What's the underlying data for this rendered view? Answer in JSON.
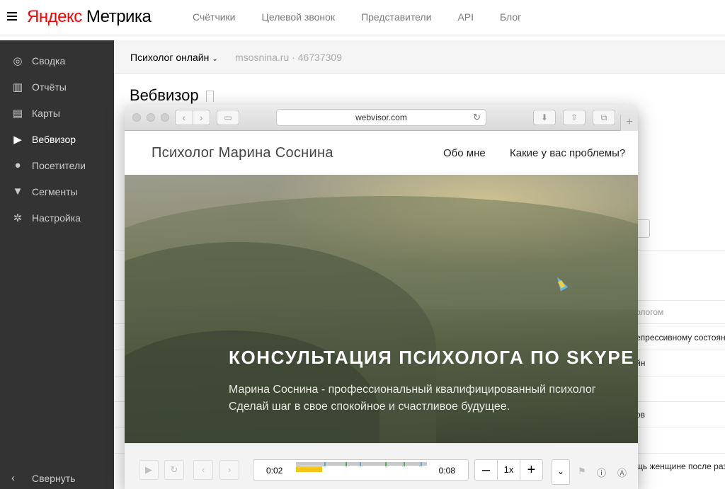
{
  "app": {
    "logo_brand": "Яндекс",
    "logo_product": "Метрика",
    "top_nav": [
      "Счётчики",
      "Целевой звонок",
      "Представители",
      "API",
      "Блог"
    ]
  },
  "sidebar": {
    "items": [
      {
        "label": "Сводка",
        "icon": "gauge-icon",
        "glyph": "◎"
      },
      {
        "label": "Отчёты",
        "icon": "bar-chart-icon",
        "glyph": "▥"
      },
      {
        "label": "Карты",
        "icon": "map-icon",
        "glyph": "▤"
      },
      {
        "label": "Вебвизор",
        "icon": "play-icon",
        "glyph": "▶"
      },
      {
        "label": "Посетители",
        "icon": "user-icon",
        "glyph": "●"
      },
      {
        "label": "Сегменты",
        "icon": "filter-icon",
        "glyph": "▼"
      },
      {
        "label": "Настройка",
        "icon": "gear-icon",
        "glyph": "✲"
      }
    ],
    "active_index": 3,
    "collapse_label": "Свернуть"
  },
  "counter_bar": {
    "counter_name": "Психолог онлайн",
    "site_info": "msosnina.ru · 46737309"
  },
  "page": {
    "title": "Вебвизор"
  },
  "background_fragments": {
    "button_text": "и",
    "column_header": "ологом",
    "cells": [
      "епрессивному состоян",
      "йн",
      "ов",
      "щь женщине после раз"
    ]
  },
  "browser": {
    "url": "webvisor.com",
    "site": {
      "name": "Психолог Марина Соснина",
      "nav": [
        "Обо мне",
        "Какие у вас проблемы?"
      ],
      "hero_title": "КОНСУЛЬТАЦИЯ ПСИХОЛОГА ПО SKYPE",
      "hero_line1": "Марина Соснина - профессиональный квалифицированный психолог",
      "hero_line2": "Сделай шаг в свое спокойное и счастливое будущее."
    }
  },
  "player": {
    "current_time": "0:02",
    "total_time": "0:08",
    "progress": 0.25,
    "speed": "1x",
    "minus": "–",
    "plus": "+",
    "colors": {
      "played": "#f5c518",
      "track": "#c8c8c8",
      "marker_blue": "#5aa9e6",
      "marker_green": "#4caf50"
    }
  }
}
